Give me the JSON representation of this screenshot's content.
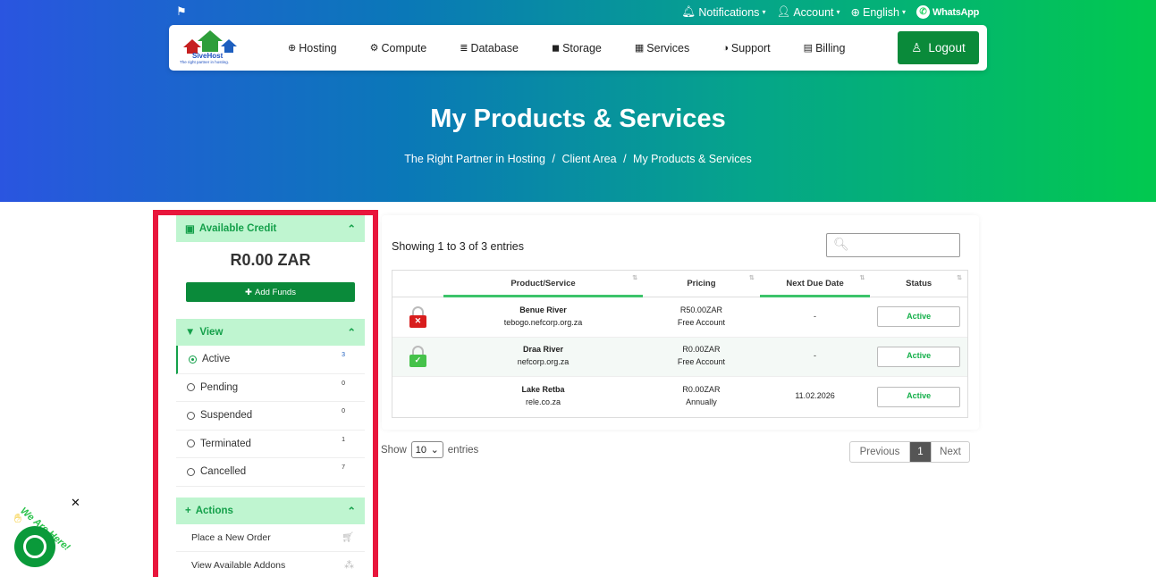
{
  "topbar": {
    "flag_icon": "flag-icon",
    "notifications": "Notifications",
    "account": "Account",
    "language": "English",
    "whatsapp": "WhatsApp"
  },
  "logo": {
    "brand": "SiveHost",
    "tagline": "The right partner in hosting."
  },
  "nav": {
    "items": [
      {
        "label": "Hosting",
        "icon": "globe-icon"
      },
      {
        "label": "Compute",
        "icon": "chip-icon"
      },
      {
        "label": "Database",
        "icon": "database-icon"
      },
      {
        "label": "Storage",
        "icon": "cube-icon"
      },
      {
        "label": "Services",
        "icon": "gift-icon"
      },
      {
        "label": "Support",
        "icon": "headset-icon"
      },
      {
        "label": "Billing",
        "icon": "invoice-icon"
      }
    ],
    "logout": "Logout"
  },
  "hero": {
    "title": "My Products & Services",
    "breadcrumb": [
      "The Right Partner in Hosting",
      "Client Area",
      "My Products & Services"
    ],
    "separator": "/"
  },
  "sidebar": {
    "credit": {
      "title": "Available Credit",
      "amount": "R0.00 ZAR",
      "add_funds": "Add Funds"
    },
    "view": {
      "title": "View",
      "items": [
        {
          "label": "Active",
          "count": "3",
          "selected": true
        },
        {
          "label": "Pending",
          "count": "0"
        },
        {
          "label": "Suspended",
          "count": "0"
        },
        {
          "label": "Terminated",
          "count": "1"
        },
        {
          "label": "Cancelled",
          "count": "7"
        }
      ]
    },
    "actions": {
      "title": "Actions",
      "items": [
        {
          "label": "Place a New Order",
          "icon": "cart-icon"
        },
        {
          "label": "View Available Addons",
          "icon": "cubes-icon"
        }
      ]
    }
  },
  "table": {
    "showing": "Showing 1 to 3 of 3 entries",
    "search_placeholder": "",
    "columns": [
      "",
      "Product/Service",
      "Pricing",
      "Next Due Date",
      "Status"
    ],
    "rows": [
      {
        "lock": "red",
        "name": "Benue River",
        "domain": "tebogo.nefcorp.org.za",
        "price": "R50.00ZAR",
        "cycle": "Free Account",
        "due": "-",
        "status": "Active"
      },
      {
        "lock": "green",
        "name": "Draa River",
        "domain": "nefcorp.org.za",
        "price": "R0.00ZAR",
        "cycle": "Free Account",
        "due": "-",
        "status": "Active"
      },
      {
        "lock": "none",
        "name": "Lake Retba",
        "domain": "rele.co.za",
        "price": "R0.00ZAR",
        "cycle": "Annually",
        "due": "11.02.2026",
        "status": "Active"
      }
    ],
    "show_label": "Show",
    "page_size": "10",
    "entries_label": "entries",
    "pager": {
      "previous": "Previous",
      "current": "1",
      "next": "Next"
    }
  },
  "chat": {
    "label": "We Are Here!",
    "close": "✕"
  },
  "colors": {
    "accent_green": "#0a8a3a",
    "highlight_red": "#e8163c",
    "panel_green": "#bff5d0"
  }
}
